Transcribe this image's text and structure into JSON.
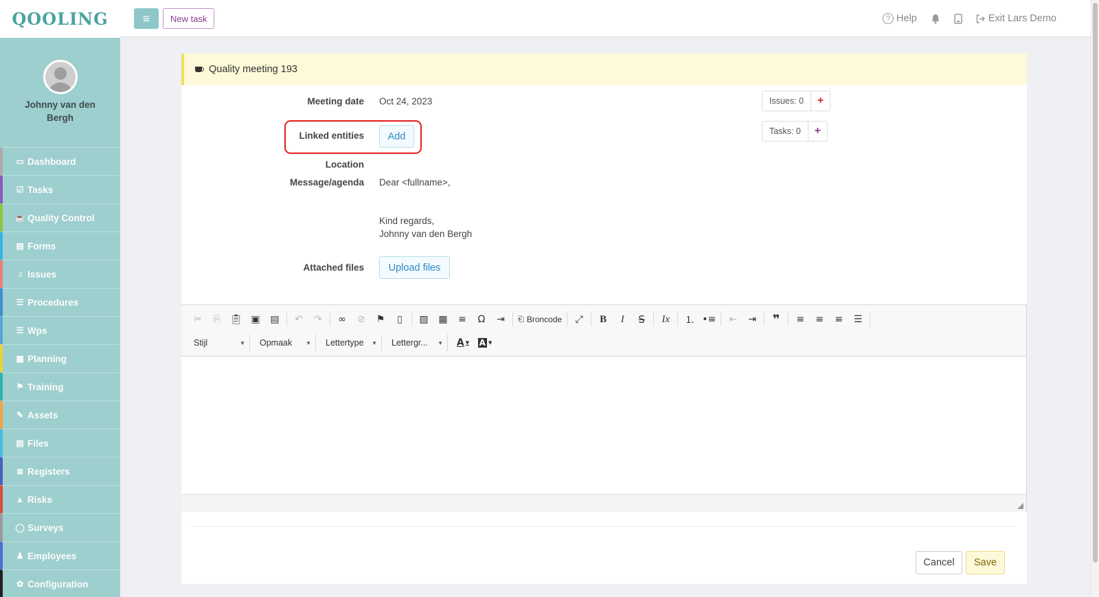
{
  "app": {
    "logo": "QOOLING"
  },
  "user": {
    "name": "Johnny van den Bergh"
  },
  "topbar": {
    "menu_icon": "≡",
    "new_task": "New task",
    "help": "Help",
    "exit": "Exit Lars Demo"
  },
  "sidebar": {
    "items": [
      {
        "label": "Dashboard",
        "icon": "▭",
        "color": "#aaaaaa"
      },
      {
        "label": "Tasks",
        "icon": "☑",
        "color": "#8a5bbf"
      },
      {
        "label": "Quality Control",
        "icon": "☕",
        "color": "#8dc73f"
      },
      {
        "label": "Forms",
        "icon": "▤",
        "color": "#35b5e5"
      },
      {
        "label": "Issues",
        "icon": "♫",
        "color": "#ef7d7d"
      },
      {
        "label": "Procedures",
        "icon": "☰",
        "color": "#3d8fd0"
      },
      {
        "label": "Wps",
        "icon": "☰",
        "color": "#5ba3dc"
      },
      {
        "label": "Planning",
        "icon": "▦",
        "color": "#e8d43a"
      },
      {
        "label": "Training",
        "icon": "⚑",
        "color": "#2cb3b0"
      },
      {
        "label": "Assets",
        "icon": "✎",
        "color": "#f0a34a"
      },
      {
        "label": "Files",
        "icon": "▤",
        "color": "#48bde0"
      },
      {
        "label": "Registers",
        "icon": "≣",
        "color": "#4b5fbf"
      },
      {
        "label": "Risks",
        "icon": "▲",
        "color": "#e04a3c"
      },
      {
        "label": "Surveys",
        "icon": "◯",
        "color": "#9a9a9a"
      },
      {
        "label": "Employees",
        "icon": "♟",
        "color": "#4e6fd0"
      },
      {
        "label": "Configuration",
        "icon": "✿",
        "color": "#222222"
      }
    ]
  },
  "meeting": {
    "title": "Quality meeting 193",
    "date_label": "Meeting date",
    "date_value": "Oct 24, 2023",
    "linked_label": "Linked entities",
    "add_label": "Add",
    "location_label": "Location",
    "message_label": "Message/agenda",
    "message_line1": "Dear <fullname>,",
    "message_line2": "Kind regards,",
    "message_line3": "Johnny van den Bergh",
    "files_label": "Attached files",
    "upload_label": "Upload files",
    "issues_count": "Issues: 0",
    "tasks_count": "Tasks: 0",
    "issues_color": "#d9262c",
    "tasks_color": "#8a3d8f"
  },
  "editor": {
    "source_label": "Broncode",
    "style_combo": "Stijl",
    "format_combo": "Opmaak",
    "font_combo": "Lettertype",
    "size_combo": "Lettergr..."
  },
  "actions": {
    "cancel": "Cancel",
    "save": "Save"
  }
}
